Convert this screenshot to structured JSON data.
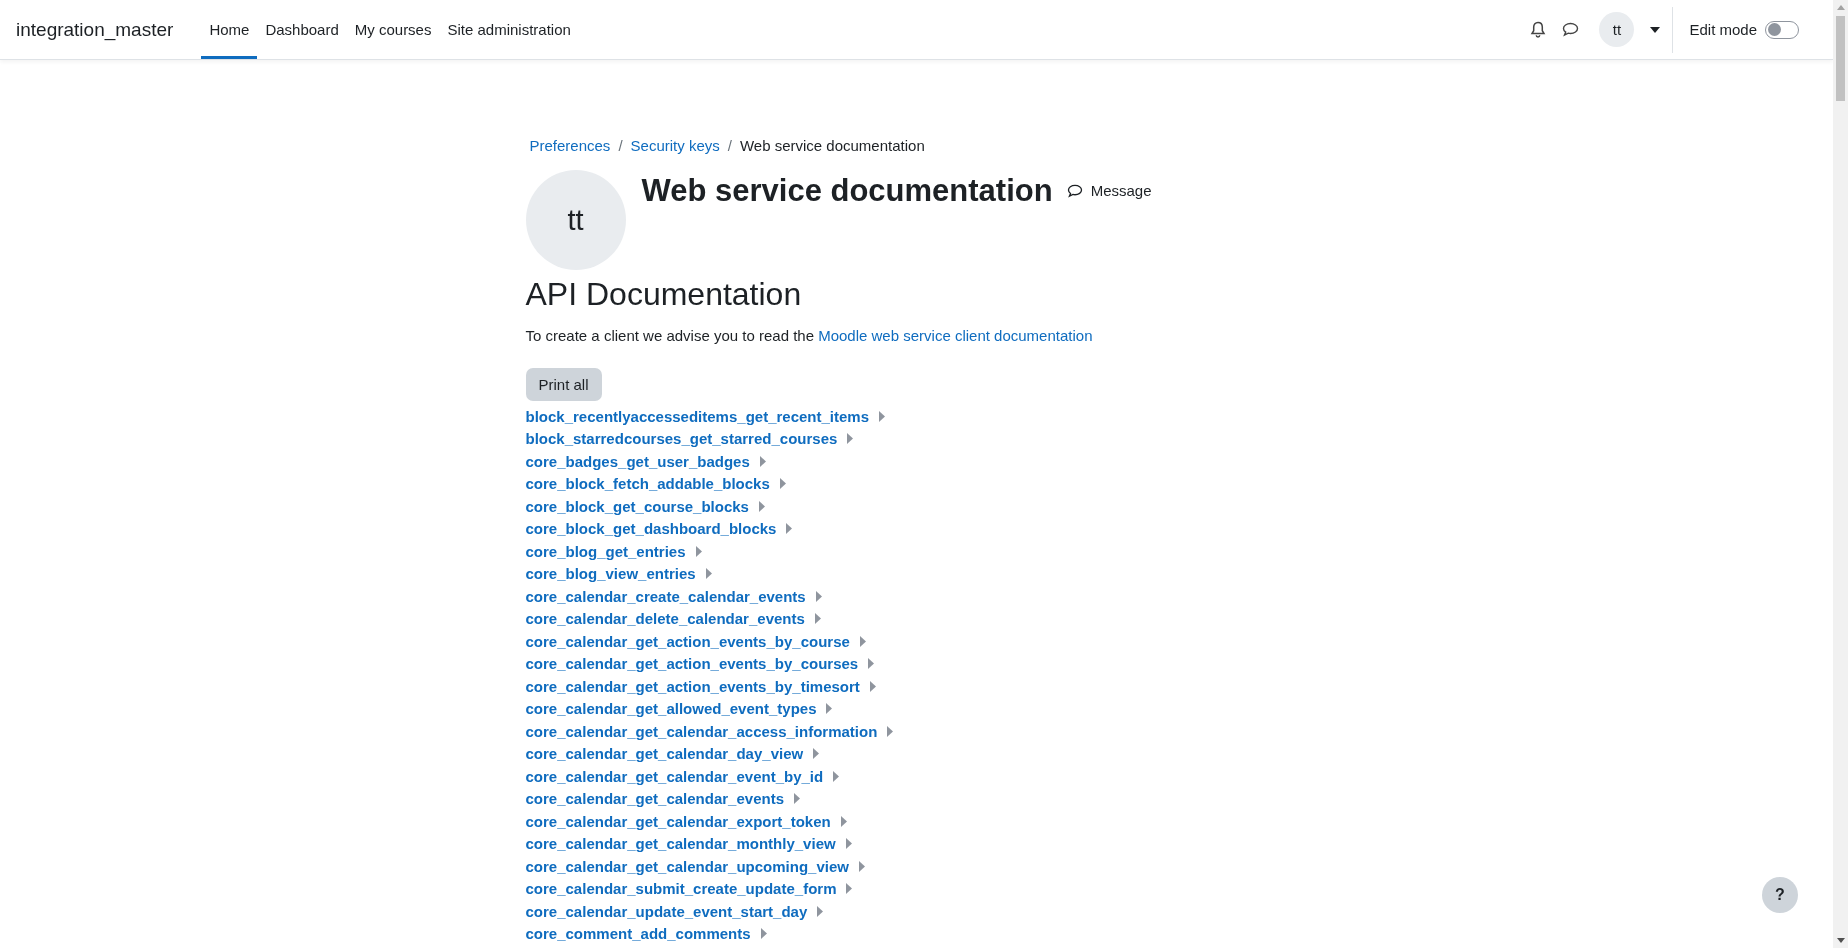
{
  "navbar": {
    "site_name": "integration_master",
    "items": [
      {
        "label": "Home",
        "selected": true
      },
      {
        "label": "Dashboard",
        "selected": false
      },
      {
        "label": "My courses",
        "selected": false
      },
      {
        "label": "Site administration",
        "selected": false
      }
    ],
    "user_initials": "tt",
    "edit_mode": {
      "label": "Edit mode",
      "on": false
    }
  },
  "breadcrumb": [
    {
      "label": "Preferences",
      "link": true
    },
    {
      "separator": "/",
      "label": "Security keys",
      "link": true
    },
    {
      "separator": "/",
      "label": "Web service documentation",
      "link": false
    }
  ],
  "header": {
    "avatar_initials": "tt",
    "title": "Web service documentation",
    "message_button": "Message"
  },
  "section_title": "API Documentation",
  "intro": {
    "text": "To create a client we advise you to read the",
    "link": "Moodle web service client documentation"
  },
  "print_button": "Print all",
  "functions": [
    {
      "name": "block_recentlyaccesseditems_get_recent_items",
      "expanded": false
    },
    {
      "name": "block_starredcourses_get_starred_courses",
      "expanded": false
    },
    {
      "name": "core_badges_get_user_badges",
      "expanded": false
    },
    {
      "name": "core_block_fetch_addable_blocks",
      "expanded": false
    },
    {
      "name": "core_block_get_course_blocks",
      "expanded": false
    },
    {
      "name": "core_block_get_dashboard_blocks",
      "expanded": false
    },
    {
      "name": "core_blog_get_entries",
      "expanded": false
    },
    {
      "name": "core_blog_view_entries",
      "expanded": false
    },
    {
      "name": "core_calendar_create_calendar_events",
      "expanded": false
    },
    {
      "name": "core_calendar_delete_calendar_events",
      "expanded": false
    },
    {
      "name": "core_calendar_get_action_events_by_course",
      "expanded": false
    },
    {
      "name": "core_calendar_get_action_events_by_courses",
      "expanded": false
    },
    {
      "name": "core_calendar_get_action_events_by_timesort",
      "expanded": false
    },
    {
      "name": "core_calendar_get_allowed_event_types",
      "expanded": false
    },
    {
      "name": "core_calendar_get_calendar_access_information",
      "expanded": false
    },
    {
      "name": "core_calendar_get_calendar_day_view",
      "expanded": false
    },
    {
      "name": "core_calendar_get_calendar_event_by_id",
      "expanded": false
    },
    {
      "name": "core_calendar_get_calendar_events",
      "expanded": false
    },
    {
      "name": "core_calendar_get_calendar_export_token",
      "expanded": false
    },
    {
      "name": "core_calendar_get_calendar_monthly_view",
      "expanded": false
    },
    {
      "name": "core_calendar_get_calendar_upcoming_view",
      "expanded": false
    },
    {
      "name": "core_calendar_submit_create_update_form",
      "expanded": false
    },
    {
      "name": "core_calendar_update_event_start_day",
      "expanded": false
    },
    {
      "name": "core_comment_add_comments",
      "expanded": false
    }
  ],
  "help_button": "?"
}
